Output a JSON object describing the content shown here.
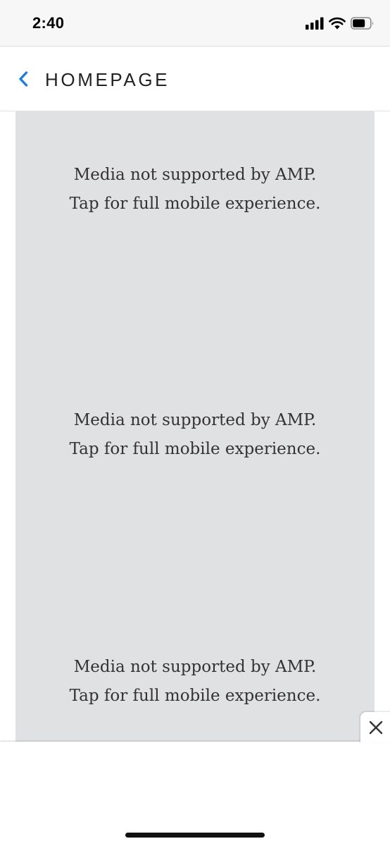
{
  "status_bar": {
    "time": "2:40",
    "icons": [
      "cellular-signal-icon",
      "wifi-icon",
      "battery-icon"
    ]
  },
  "nav": {
    "back_icon": "chevron-left-icon",
    "title": "HOMEPAGE",
    "accent_color": "#1a7fd6"
  },
  "content": {
    "background_color": "#e0e1e3",
    "media_placeholders": [
      {
        "line1": "Media not supported by AMP.",
        "line2": "Tap for full mobile experience."
      },
      {
        "line1": "Media not supported by AMP.",
        "line2": "Tap for full mobile experience."
      },
      {
        "line1": "Media not supported by AMP.",
        "line2": "Tap for full mobile experience."
      }
    ]
  },
  "footer": {
    "close_icon": "close-icon"
  }
}
